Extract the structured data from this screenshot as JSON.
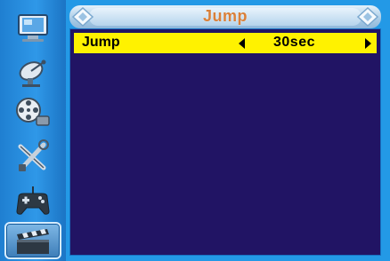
{
  "osd": {
    "title": "Jump",
    "active_section": "media"
  },
  "sidebar": {
    "items": [
      {
        "icon": "monitor-icon"
      },
      {
        "icon": "satellite-dish-icon"
      },
      {
        "icon": "film-reel-icon"
      },
      {
        "icon": "tools-icon"
      },
      {
        "icon": "gamepad-icon"
      },
      {
        "icon": "clapperboard-icon",
        "selected": true
      }
    ]
  },
  "setting": {
    "label": "Jump",
    "value": "30sec"
  },
  "colors": {
    "sidebar_blue": "#2f98e8",
    "panel_blue": "#2399e6",
    "content_bg": "#211464",
    "highlight": "#fff200",
    "title_color": "#d9803a"
  }
}
